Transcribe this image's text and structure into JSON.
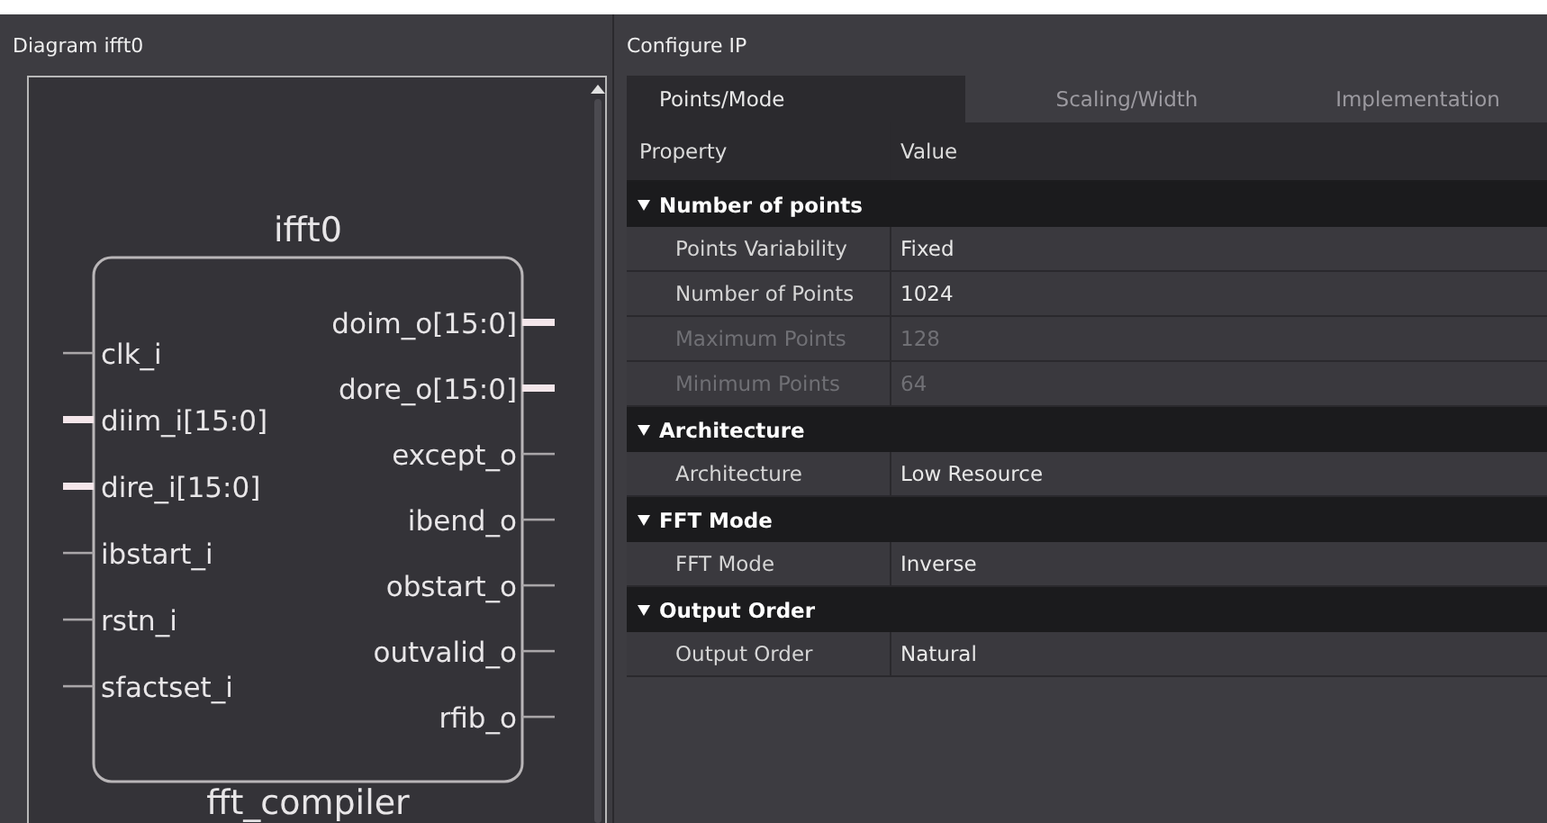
{
  "diagram": {
    "title": "Diagram ifft0",
    "instance": "ifft0",
    "module": "fft_compiler",
    "inputs": [
      {
        "name": "clk_i",
        "bus": false
      },
      {
        "name": "diim_i[15:0]",
        "bus": true
      },
      {
        "name": "dire_i[15:0]",
        "bus": true
      },
      {
        "name": "ibstart_i",
        "bus": false
      },
      {
        "name": "rstn_i",
        "bus": false
      },
      {
        "name": "sfactset_i",
        "bus": false
      }
    ],
    "outputs": [
      {
        "name": "doim_o[15:0]",
        "bus": true
      },
      {
        "name": "dore_o[15:0]",
        "bus": true
      },
      {
        "name": "except_o",
        "bus": false
      },
      {
        "name": "ibend_o",
        "bus": false
      },
      {
        "name": "obstart_o",
        "bus": false
      },
      {
        "name": "outvalid_o",
        "bus": false
      },
      {
        "name": "rfib_o",
        "bus": false
      }
    ]
  },
  "configure": {
    "title": "Configure IP",
    "tabs": [
      {
        "label": "Points/Mode",
        "selected": true
      },
      {
        "label": "Scaling/Width",
        "selected": false
      },
      {
        "label": "Implementation",
        "selected": false
      }
    ],
    "columns": [
      "Property",
      "Value"
    ],
    "groups": [
      {
        "label": "Number of points",
        "expanded": true,
        "rows": [
          {
            "property": "Points Variability",
            "value": "Fixed",
            "disabled": false
          },
          {
            "property": "Number of Points",
            "value": "1024",
            "disabled": false
          },
          {
            "property": "Maximum Points",
            "value": "128",
            "disabled": true
          },
          {
            "property": "Minimum Points",
            "value": "64",
            "disabled": true
          }
        ]
      },
      {
        "label": "Architecture",
        "expanded": true,
        "rows": [
          {
            "property": "Architecture",
            "value": "Low Resource",
            "disabled": false
          }
        ]
      },
      {
        "label": "FFT Mode",
        "expanded": true,
        "rows": [
          {
            "property": "FFT Mode",
            "value": "Inverse",
            "disabled": false
          }
        ]
      },
      {
        "label": "Output Order",
        "expanded": true,
        "rows": [
          {
            "property": "Output Order",
            "value": "Natural",
            "disabled": false
          }
        ]
      }
    ]
  }
}
